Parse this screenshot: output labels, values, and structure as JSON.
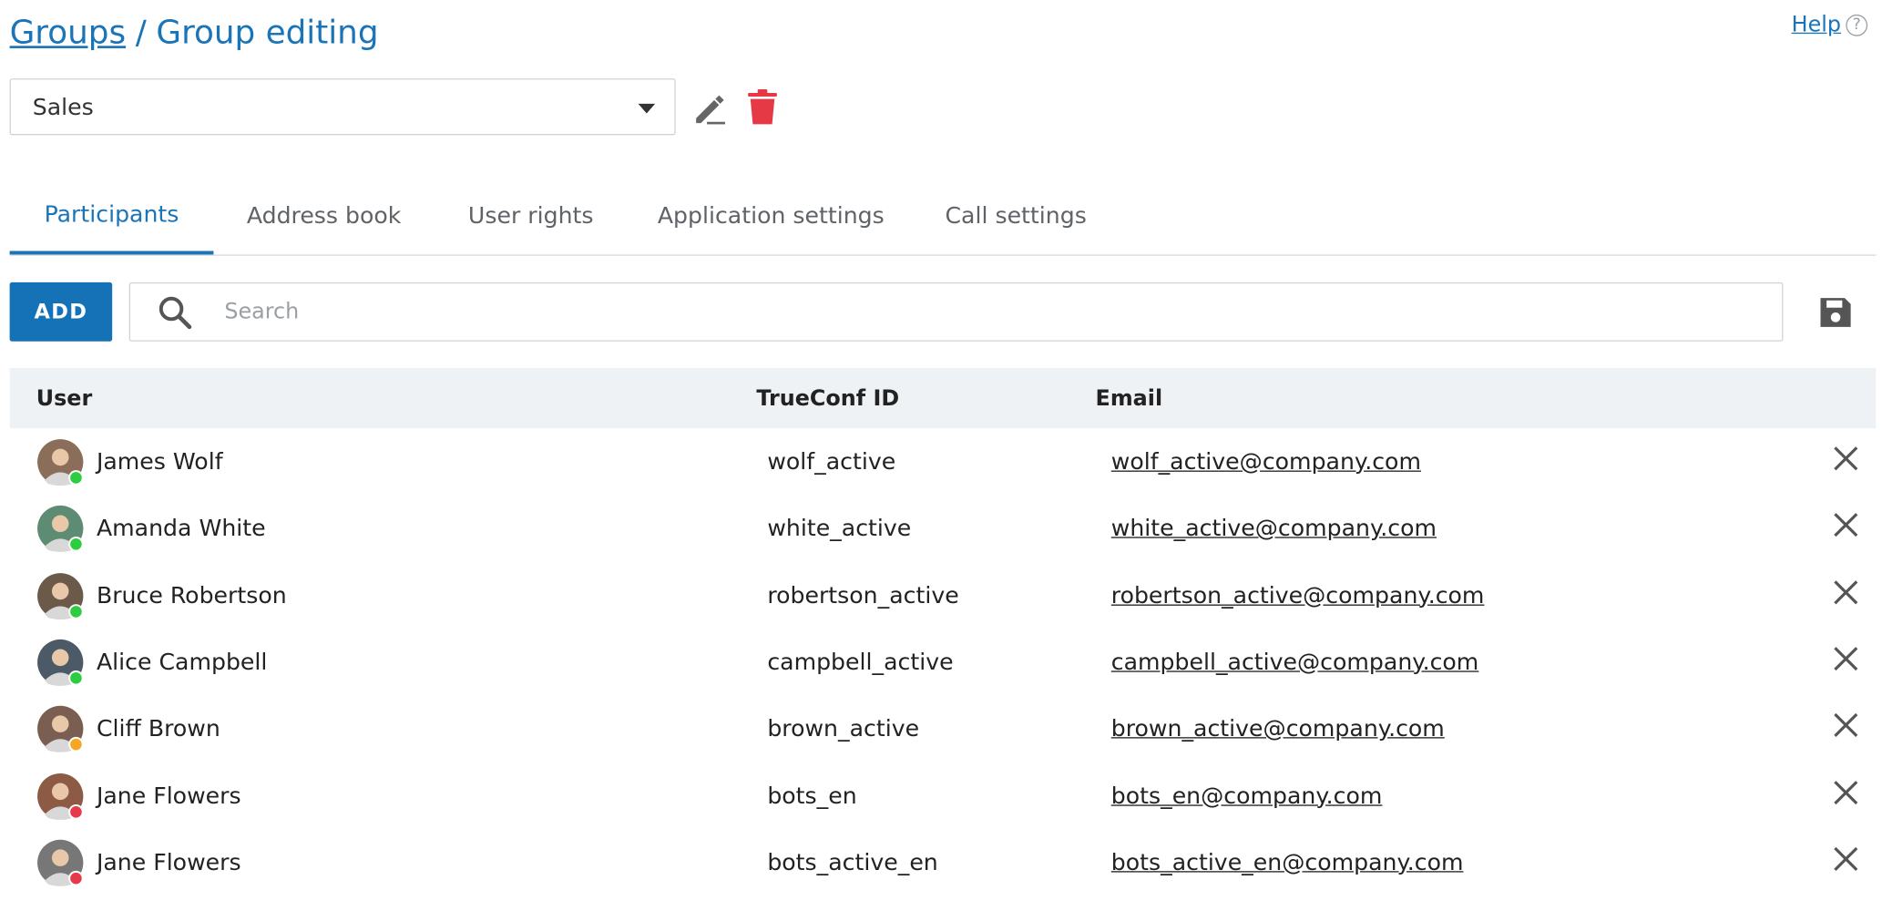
{
  "breadcrumb": {
    "parent": "Groups",
    "separator": "/",
    "current": "Group editing"
  },
  "help": {
    "label": "Help",
    "icon": "?"
  },
  "group_select": {
    "value": "Sales"
  },
  "tabs": [
    {
      "label": "Participants",
      "active": true
    },
    {
      "label": "Address book",
      "active": false
    },
    {
      "label": "User rights",
      "active": false
    },
    {
      "label": "Application settings",
      "active": false
    },
    {
      "label": "Call settings",
      "active": false
    }
  ],
  "toolbar": {
    "add_label": "ADD",
    "search_placeholder": "Search"
  },
  "table": {
    "columns": {
      "user": "User",
      "trueconf_id": "TrueConf ID",
      "email": "Email"
    },
    "rows": [
      {
        "name": "James Wolf",
        "id": "wolf_active",
        "email": "wolf_active@company.com",
        "status": "online",
        "avatar_bg": "#8a6e5a"
      },
      {
        "name": "Amanda White",
        "id": "white_active",
        "email": "white_active@company.com",
        "status": "online",
        "avatar_bg": "#5e8b73"
      },
      {
        "name": "Bruce Robertson",
        "id": "robertson_active",
        "email": "robertson_active@company.com",
        "status": "online",
        "avatar_bg": "#6b5a4a"
      },
      {
        "name": "Alice Campbell",
        "id": "campbell_active",
        "email": "campbell_active@company.com",
        "status": "online",
        "avatar_bg": "#4b5a66"
      },
      {
        "name": "Cliff Brown",
        "id": "brown_active",
        "email": "brown_active@company.com",
        "status": "away",
        "avatar_bg": "#7a5e52"
      },
      {
        "name": "Jane Flowers",
        "id": "bots_en",
        "email": "bots_en@company.com",
        "status": "busy",
        "avatar_bg": "#8c5a45"
      },
      {
        "name": "Jane Flowers",
        "id": "bots_active_en",
        "email": "bots_active_en@company.com",
        "status": "busy",
        "avatar_bg": "#777777"
      }
    ]
  },
  "colors": {
    "accent": "#1a74b8",
    "delete": "#e53945",
    "status_online": "#2ecc40",
    "status_away": "#f5a623",
    "status_busy": "#e8394a"
  },
  "icons": {
    "edit": "pencil-icon",
    "delete": "trash-icon",
    "search": "search-icon",
    "save": "save-icon",
    "remove": "close-icon",
    "dropdown": "caret-down-icon"
  }
}
